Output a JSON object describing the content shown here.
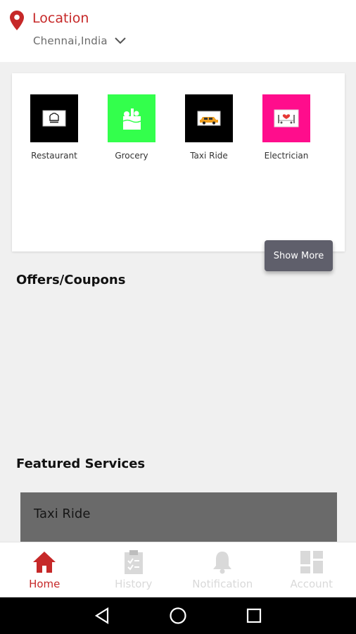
{
  "header": {
    "location_title": "Location",
    "city": "Chennai,India"
  },
  "categories": [
    {
      "label": "Restaurant",
      "tile_color": "#000000",
      "icon": "chef-hat-icon"
    },
    {
      "label": "Grocery",
      "tile_color": "#33ff4c",
      "icon": "grocery-bag-icon"
    },
    {
      "label": "Taxi Ride",
      "tile_color": "#000000",
      "icon": "taxi-icon"
    },
    {
      "label": "Electrician",
      "tile_color": "#ff0d8c",
      "icon": "electrician-icon"
    }
  ],
  "show_more_label": "Show More",
  "offers_title": "Offers/Coupons",
  "featured_title": "Featured Services",
  "featured_items": [
    {
      "label": "Taxi Ride"
    }
  ],
  "bottom_nav": [
    {
      "label": "Home",
      "icon": "home-icon",
      "active": true
    },
    {
      "label": "History",
      "icon": "clipboard-icon",
      "active": false
    },
    {
      "label": "Notification",
      "icon": "bell-icon",
      "active": false
    },
    {
      "label": "Account",
      "icon": "grid-icon",
      "active": false
    }
  ],
  "colors": {
    "accent": "#c62828",
    "inactive": "#d9d9d9",
    "background": "#f0f0f0"
  }
}
